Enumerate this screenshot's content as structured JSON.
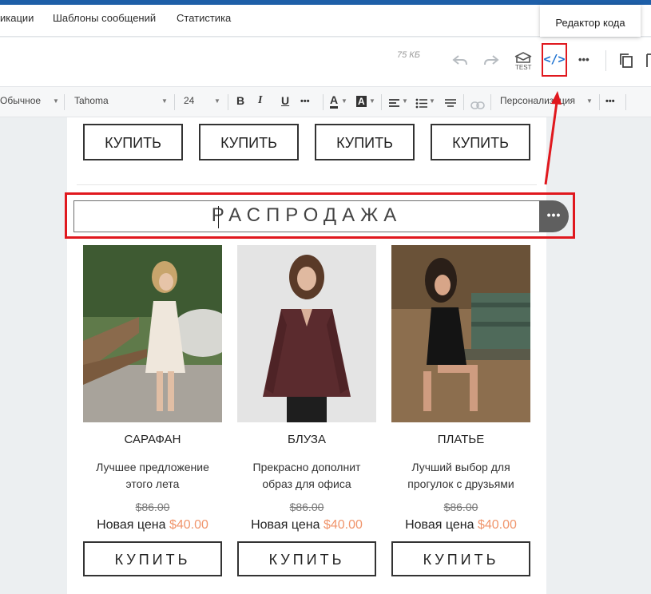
{
  "nav": {
    "items": [
      "икации",
      "Шаблоны сообщений",
      "Статистика"
    ]
  },
  "tooltip": {
    "text": "Редактор кода"
  },
  "toolbar": {
    "size_label": "75 КБ",
    "test_label": "TEST",
    "code_icon_label": "</>",
    "more": "•••"
  },
  "format_bar": {
    "style": "Обычное",
    "font": "Tahoma",
    "size": "24",
    "bold": "B",
    "italic": "I",
    "underline": "U",
    "more": "•••",
    "text_color": "A",
    "bg_color": "A",
    "personalization": "Персонализация"
  },
  "email": {
    "top_buttons": [
      "КУПИТЬ",
      "КУПИТЬ",
      "КУПИТЬ",
      "КУПИТЬ"
    ],
    "sale_heading": "РАСПРОДАЖА",
    "more_handle": "•••",
    "products": [
      {
        "name": "САРАФАН",
        "desc_lines": [
          "Лучшее предложение",
          "этого лета"
        ],
        "old_price": "$86.00",
        "new_price_label": "Новая цена",
        "new_price": "$40.00",
        "button": "КУПИТЬ"
      },
      {
        "name": "БЛУЗА",
        "desc_lines": [
          "Прекрасно дополнит",
          "образ для офиса"
        ],
        "old_price": "$86.00",
        "new_price_label": "Новая цена",
        "new_price": "$40.00",
        "button": "КУПИТЬ"
      },
      {
        "name": "ПЛАТЬЕ",
        "desc_lines": [
          "Лучший выбор для",
          "прогулок с друзьями"
        ],
        "old_price": "$86.00",
        "new_price_label": "Новая цена",
        "new_price": "$40.00",
        "button": "КУПИТЬ"
      }
    ]
  },
  "colors": {
    "highlight": "#e0181e",
    "accent_price": "#f0956c",
    "code_icon": "#1f73d1",
    "brand_bar": "#1e5fa8"
  }
}
